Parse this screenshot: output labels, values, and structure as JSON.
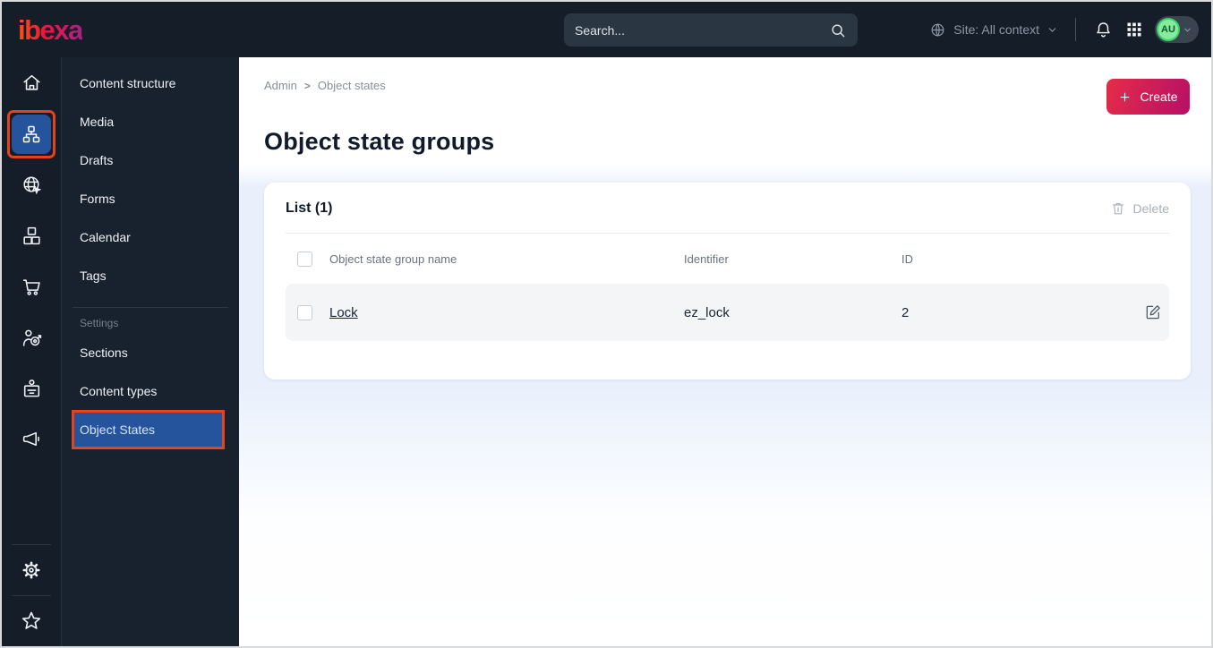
{
  "topbar": {
    "logo": "ibexa",
    "search_placeholder": "Search...",
    "site_context": "Site: All context",
    "avatar": "AU"
  },
  "iconbar": {
    "icons": [
      "home-icon",
      "site-tree-icon",
      "global-search-icon",
      "blocks-icon",
      "cart-icon",
      "personalization-icon",
      "members-icon",
      "promotions-icon",
      "settings-gear-icon",
      "bookmarks-star-icon"
    ],
    "selected": "site-tree-icon"
  },
  "sidebar": {
    "items": [
      "Content structure",
      "Media",
      "Drafts",
      "Forms",
      "Calendar",
      "Tags"
    ],
    "section_label": "Settings",
    "settings_items": [
      "Sections",
      "Content types",
      "Object States"
    ],
    "selected": "Object States"
  },
  "breadcrumb": {
    "items": [
      "Admin",
      "Object states"
    ],
    "separator": ">"
  },
  "page": {
    "title": "Object state groups",
    "create_label": "Create"
  },
  "list": {
    "title": "List (1)",
    "delete_label": "Delete",
    "columns": [
      "Object state group name",
      "Identifier",
      "ID"
    ],
    "rows": [
      {
        "name": "Lock",
        "identifier": "ez_lock",
        "id": "2"
      }
    ]
  },
  "colors": {
    "topbar_bg": "#141d28",
    "sidebar_bg": "#18222e",
    "selected_blue": "#25549c",
    "annotation_orange": "#e5431c",
    "primary_gradient_start": "#e62c49",
    "primary_gradient_end": "#b60f67",
    "avatar_green": "#86eb9e",
    "content_band_blue": "#e9f0fc"
  }
}
